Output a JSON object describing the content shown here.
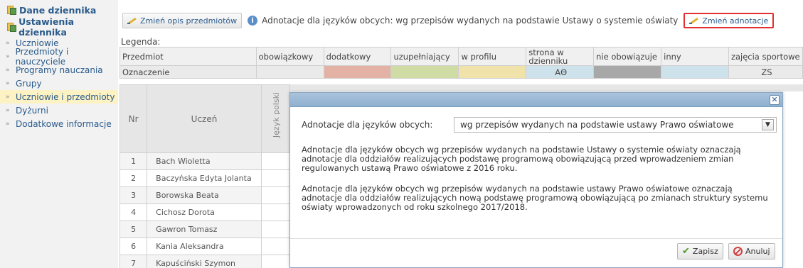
{
  "sidebar": {
    "heading1": "Dane dziennika",
    "heading2": "Ustawienia dziennika",
    "items": [
      {
        "label": "Uczniowie"
      },
      {
        "label": "Przedmioty i nauczyciele"
      },
      {
        "label": "Programy nauczania"
      },
      {
        "label": "Grupy"
      },
      {
        "label": "Uczniowie i przedmioty"
      },
      {
        "label": "Dyżurni"
      },
      {
        "label": "Dodatkowe informacje"
      }
    ],
    "active_index": 4
  },
  "toolbar": {
    "change_desc_label": "Zmień opis przedmiotów",
    "info_text": "Adnotacje dla języków obcych: wg przepisów wydanych na podstawie Ustawy o systemie oświaty",
    "change_annot_label": "Zmień adnotacje"
  },
  "legend": {
    "label": "Legenda:",
    "headers": [
      "Przedmiot",
      "obowiązkowy",
      "dodatkowy",
      "uzupełniający",
      "w profilu",
      "strona w dzienniku",
      "nie obowiązuje",
      "inny",
      "zajęcia sportowe"
    ],
    "row2_label": "Oznaczenie",
    "strona_mark": "AΘ",
    "zs_mark": "ZS"
  },
  "students": {
    "nr_header": "Nr",
    "name_header": "Uczeń",
    "lang_header": "Język polski",
    "rows": [
      {
        "nr": "1",
        "name": "Bach Wioletta"
      },
      {
        "nr": "2",
        "name": "Baczyńska Edyta Jolanta"
      },
      {
        "nr": "3",
        "name": "Borowska Beata"
      },
      {
        "nr": "4",
        "name": "Cichosz Dorota"
      },
      {
        "nr": "5",
        "name": "Gawron Tomasz"
      },
      {
        "nr": "6",
        "name": "Kania Aleksandra"
      },
      {
        "nr": "7",
        "name": "Kapuściński Szymon"
      }
    ]
  },
  "dialog": {
    "field_label": "Adnotacje dla języków obcych:",
    "select_value": "wg przepisów wydanych na podstawie ustawy Prawo oświatowe",
    "para1": "Adnotacje dla języków obcych wg przepisów wydanych na podstawie Ustawy o systemie oświaty oznaczają adnotacje dla oddziałów realizujących podstawę programową obowiązującą przed wprowadzeniem zmian regulowanych ustawą Prawo oświatowe z 2016 roku.",
    "para2": "Adnotacje dla języków obcych wg przepisów wydanych na podstawie ustawy Prawo oświatowe oznaczają adnotacje dla oddziałów realizujących nową podstawę programową obowiązującą po zmianach struktury systemu oświaty wprowadzonych od roku szkolnego 2017/2018.",
    "save_label": "Zapisz",
    "cancel_label": "Anuluj",
    "close_glyph": "✕"
  },
  "colors": {
    "dodatkowy": "#e3b2a4",
    "uzupelniajacy": "#cfdca4",
    "w_profilu": "#f0e2a8",
    "nie_obowiazuje": "#a8a8a8",
    "inny": "#cde2ea",
    "highlight_border": "#e03030"
  }
}
